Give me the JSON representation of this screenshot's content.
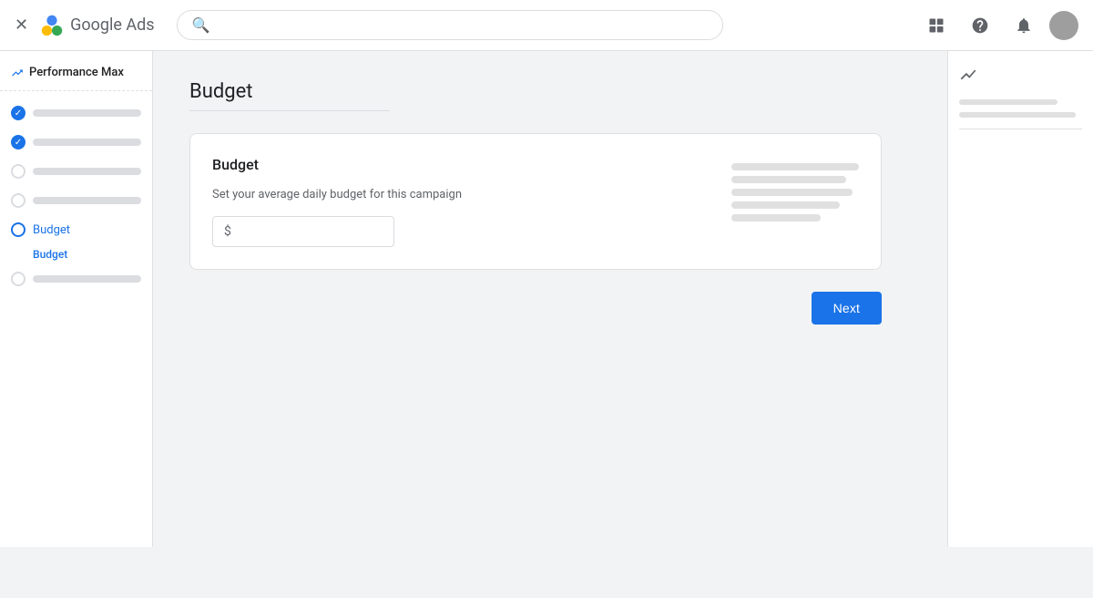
{
  "nav": {
    "close_icon": "✕",
    "logo_text": "Google Ads",
    "search_placeholder": "",
    "icons": {
      "grid": "⊞",
      "help": "?",
      "bell": "🔔"
    }
  },
  "sidebar": {
    "title": "Performance Max",
    "items": [
      {
        "id": "item1",
        "state": "checked",
        "label": ""
      },
      {
        "id": "item2",
        "state": "checked",
        "label": ""
      },
      {
        "id": "item3",
        "state": "empty",
        "label": ""
      },
      {
        "id": "item4",
        "state": "empty",
        "label": ""
      },
      {
        "id": "budget",
        "state": "active",
        "label": "Budget"
      },
      {
        "id": "item6",
        "state": "empty",
        "label": ""
      }
    ],
    "sub_item": "Budget"
  },
  "main": {
    "page_title": "Budget",
    "card": {
      "title": "Budget",
      "description": "Set your average daily budget for this campaign",
      "currency_symbol": "$",
      "input_placeholder": ""
    },
    "next_button": "Next"
  }
}
